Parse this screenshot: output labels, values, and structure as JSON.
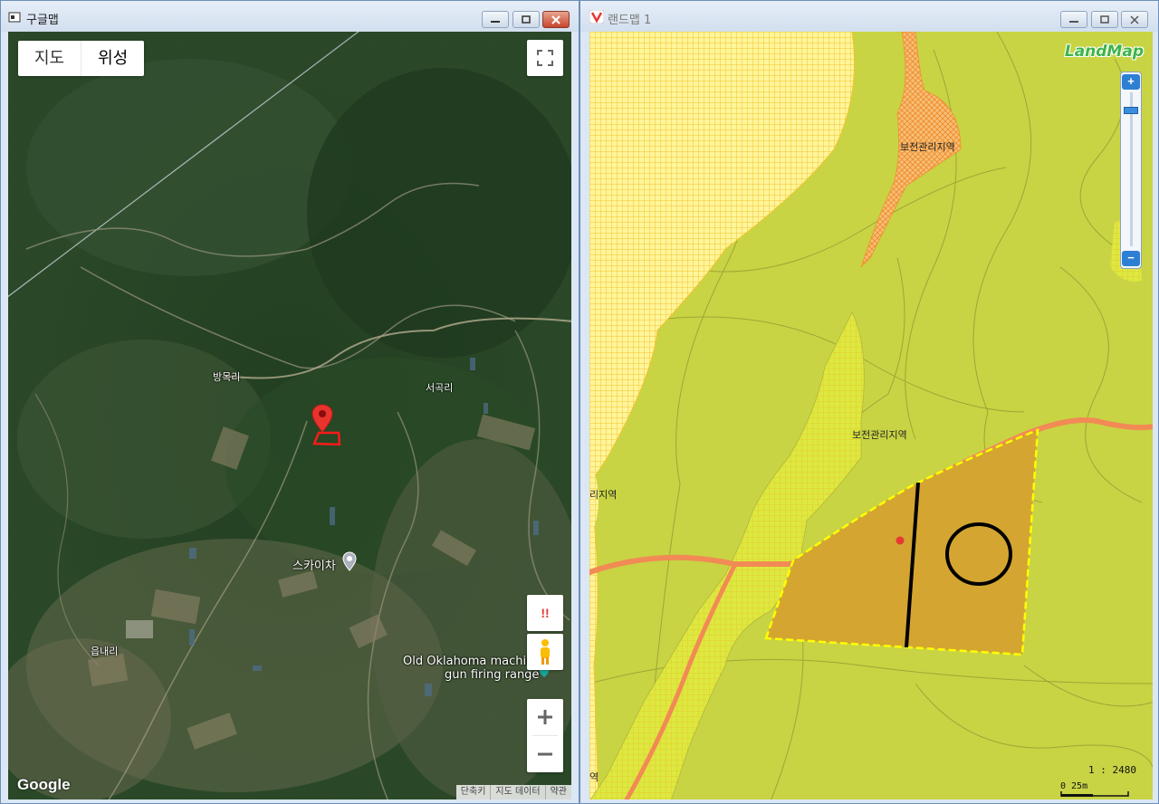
{
  "left_window": {
    "title": "구글맵",
    "map_type": {
      "map_label": "지도",
      "satellite_label": "위성"
    },
    "places": {
      "bangmok": "방목리",
      "seogok": "서곡리",
      "skycha": "스카이차",
      "eupnae": "읍내리",
      "oklahoma_line1": "Old Oklahoma machin",
      "oklahoma_line2": "gun firing range"
    },
    "pegman_warning": "!!",
    "logo": "Google",
    "attribution": [
      "단축키",
      "지도 데이터",
      "약관"
    ]
  },
  "right_window": {
    "title": "랜드맵 1",
    "logo": "LandMap",
    "zones": {
      "zone_top": "보전관리지역",
      "zone_mid": "보전관리지역",
      "zone_left": "리지역",
      "zone_bottom": "역"
    },
    "scale_ratio": "1 : 2480",
    "scale_bar_text": "0   25m"
  },
  "colors": {
    "landmap_base": "#c8d444",
    "parcel_fill": "#d4a530",
    "parcel_border": "#ffff00",
    "road": "#f28a55",
    "marker_red": "#e53935"
  }
}
